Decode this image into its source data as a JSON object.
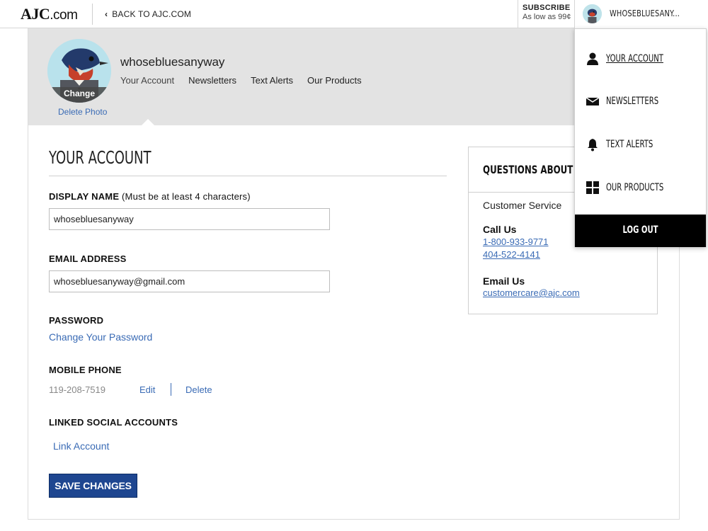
{
  "header": {
    "logo_main": "AJC",
    "logo_suffix": ".com",
    "back_label": "BACK TO AJC.COM",
    "subscribe_title": "SUBSCRIBE",
    "subscribe_price": "As low as 99¢",
    "username_short": "WHOSEBLUESANY..."
  },
  "profile": {
    "username": "whosebluesanyway",
    "change_photo_label": "Change",
    "delete_photo_label": "Delete Photo",
    "nav": [
      "Your Account",
      "Newsletters",
      "Text Alerts",
      "Our Products"
    ]
  },
  "account": {
    "title": "YOUR ACCOUNT",
    "display_name_label": "DISPLAY NAME",
    "display_name_hint": "(Must be at least 4 characters)",
    "display_name_value": "whosebluesanyway",
    "email_label": "EMAIL ADDRESS",
    "email_value": "whosebluesanyway@gmail.com",
    "password_label": "PASSWORD",
    "change_password_link": "Change Your Password",
    "mobile_label": "MOBILE PHONE",
    "mobile_value": "119-208-7519",
    "mobile_edit": "Edit",
    "mobile_delete": "Delete",
    "social_label": "LINKED SOCIAL ACCOUNTS",
    "link_account": "Link Account",
    "save_label": "SAVE CHANGES"
  },
  "questions": {
    "title": "QUESTIONS ABOUT Y",
    "customer_service": "Customer Service",
    "call_label": "Call Us",
    "phone1": "1-800-933-9771",
    "phone2": "404-522-4141",
    "email_label": "Email Us",
    "email": "customercare@ajc.com"
  },
  "dropdown": {
    "items": [
      {
        "label": "YOUR ACCOUNT",
        "icon": "person-icon"
      },
      {
        "label": "NEWSLETTERS",
        "icon": "envelope-icon"
      },
      {
        "label": "TEXT ALERTS",
        "icon": "bell-icon"
      },
      {
        "label": "OUR PRODUCTS",
        "icon": "grid-icon"
      }
    ],
    "logout_label": "LOG OUT"
  },
  "colors": {
    "link_blue": "#3a6bb5",
    "button_blue": "#1e4690",
    "header_gray": "#e3e3e3"
  }
}
